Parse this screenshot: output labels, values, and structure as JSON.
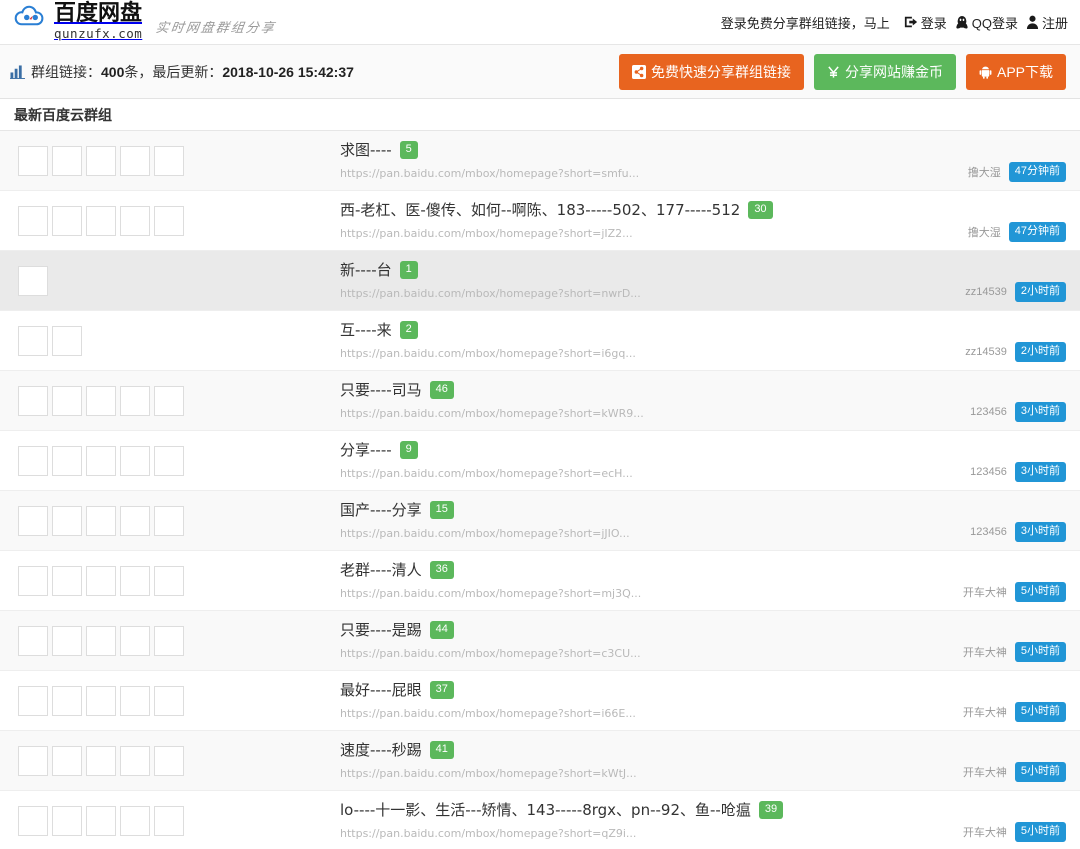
{
  "header": {
    "brand_name": "百度网盘",
    "brand_domain": "qunzufx.com",
    "slogan": "实时网盘群组分享",
    "login_hint": "登录免费分享群组链接，马上",
    "login_label": "登录",
    "qq_login_label": "QQ登录",
    "register_label": "注册",
    "icons": {
      "logo": "baidu-cloud-logo-icon",
      "login": "sign-in-icon",
      "qq": "qq-penguin-icon",
      "register": "user-icon"
    }
  },
  "stats": {
    "icon": "bar-chart-icon",
    "prefix": "群组链接：",
    "count": "400",
    "unit": "条",
    "separator": "，最后更新：",
    "updated_at": "2018-10-26 15:42:37"
  },
  "toolbar": {
    "share_link_button": "免费快速分享群组链接",
    "share_site_button": "分享网站赚金币",
    "app_download_button": "APP下载",
    "icons": {
      "share": "share-nodes-icon",
      "coin": "yen-coin-icon",
      "app": "android-robot-icon"
    },
    "colors": {
      "orange": "#e8641f",
      "green": "#5cb85c"
    }
  },
  "panel": {
    "title": "最新百度云群组"
  },
  "colors": {
    "count_badge": "#5cb85c",
    "time_badge": "#2196d6",
    "row_odd": "#f9f9f9",
    "row_hover": "#eaeaea",
    "url_text": "#b9b9b9"
  },
  "rows": [
    {
      "title": "求图----",
      "count": "5",
      "url": "https://pan.baidu.com/mbox/homepage?short=smfu...",
      "user": "撸大湿",
      "time": "47分钟前",
      "avatars": [
        "photo",
        "photo",
        "photo",
        "photo",
        "photo"
      ],
      "shade": "odd"
    },
    {
      "title": "西-老杠、医-傻传、如何--啊陈、183-----502、177-----512",
      "count": "30",
      "url": "https://pan.baidu.com/mbox/homepage?short=jIZ2...",
      "user": "撸大湿",
      "time": "47分钟前",
      "avatars": [
        "default",
        "photo",
        "default",
        "default",
        "photo"
      ],
      "shade": "white"
    },
    {
      "title": "新----台",
      "count": "1",
      "url": "https://pan.baidu.com/mbox/homepage?short=nwrD...",
      "user": "zz14539",
      "time": "2小时前",
      "avatars": [
        "default"
      ],
      "shade": "hover"
    },
    {
      "title": "互----来",
      "count": "2",
      "url": "https://pan.baidu.com/mbox/homepage?short=i6gq...",
      "user": "zz14539",
      "time": "2小时前",
      "avatars": [
        "default",
        "photo"
      ],
      "shade": "white"
    },
    {
      "title": "只要----司马",
      "count": "46",
      "url": "https://pan.baidu.com/mbox/homepage?short=kWR9...",
      "user": "123456",
      "time": "3小时前",
      "avatars": [
        "photo",
        "photo",
        "photo",
        "default",
        "default"
      ],
      "shade": "odd"
    },
    {
      "title": "分享----",
      "count": "9",
      "url": "https://pan.baidu.com/mbox/homepage?short=ecH...",
      "user": "123456",
      "time": "3小时前",
      "avatars": [
        "photo",
        "photo",
        "photo",
        "photo",
        "photo"
      ],
      "shade": "white"
    },
    {
      "title": "国产----分享",
      "count": "15",
      "url": "https://pan.baidu.com/mbox/homepage?short=jJIO...",
      "user": "123456",
      "time": "3小时前",
      "avatars": [
        "default",
        "default",
        "photo",
        "photo",
        "photo"
      ],
      "shade": "odd"
    },
    {
      "title": "老群----清人",
      "count": "36",
      "url": "https://pan.baidu.com/mbox/homepage?short=mj3Q...",
      "user": "开车大神",
      "time": "5小时前",
      "avatars": [
        "photo",
        "default",
        "default",
        "default",
        "default"
      ],
      "shade": "white"
    },
    {
      "title": "只要----是踢",
      "count": "44",
      "url": "https://pan.baidu.com/mbox/homepage?short=c3CU...",
      "user": "开车大神",
      "time": "5小时前",
      "avatars": [
        "photo",
        "photo",
        "photo",
        "default",
        "default"
      ],
      "shade": "odd"
    },
    {
      "title": "最好----屁眼",
      "count": "37",
      "url": "https://pan.baidu.com/mbox/homepage?short=i66E...",
      "user": "开车大神",
      "time": "5小时前",
      "avatars": [
        "photo",
        "photo",
        "photo",
        "default",
        "default"
      ],
      "shade": "white"
    },
    {
      "title": "速度----秒踢",
      "count": "41",
      "url": "https://pan.baidu.com/mbox/homepage?short=kWtJ...",
      "user": "开车大神",
      "time": "5小时前",
      "avatars": [
        "default",
        "default",
        "default",
        "default",
        "photo"
      ],
      "shade": "odd"
    },
    {
      "title": "lo----十一影、生活---矫情、143-----8rgx、pn--92、鱼--呛瘟",
      "count": "39",
      "url": "https://pan.baidu.com/mbox/homepage?short=qZ9i...",
      "user": "开车大神",
      "time": "5小时前",
      "avatars": [
        "photo",
        "photo",
        "photo",
        "default",
        "default"
      ],
      "shade": "white"
    }
  ],
  "avatar_art": [
    [
      "#2b2b2b",
      "#f0d0c8",
      "#e8e8e8"
    ],
    [
      "#3c8a5a",
      "#d8e8d0",
      "#2f6b45"
    ],
    [
      "#4a7fb5",
      "#d8e4ee",
      "#2c5a88"
    ],
    [
      "#3a3028",
      "#c9b59c",
      "#6b5840"
    ],
    [
      "#e8d060",
      "#f6eec0",
      "#b8a040"
    ],
    [
      "#8a6a50",
      "#e8d8c8",
      "#5a4030"
    ],
    [
      "#d8a070",
      "#f0e0d0",
      "#a87048"
    ],
    [
      "#2a2a3a",
      "#5a5a7a",
      "#101018"
    ],
    [
      "#b03030",
      "#f0c0c0",
      "#701818"
    ],
    [
      "#2c3550",
      "#8fa0c0",
      "#141c30"
    ],
    [
      "#e0c8a8",
      "#f8f0e0",
      "#b09868"
    ],
    [
      "#b82d2d",
      "#f0d8c0",
      "#7a1c1c"
    ],
    [
      "#d0c8b0",
      "#f4f0e4",
      "#988f78"
    ],
    [
      "#687048",
      "#c8d0a0",
      "#3c4028"
    ],
    [
      "#1a1a1a",
      "#888888",
      "#000000"
    ],
    [
      "#c0504d",
      "#f2dcdb",
      "#8c3330"
    ],
    [
      "#e8a030",
      "#f8e0b0",
      "#b07010"
    ]
  ]
}
